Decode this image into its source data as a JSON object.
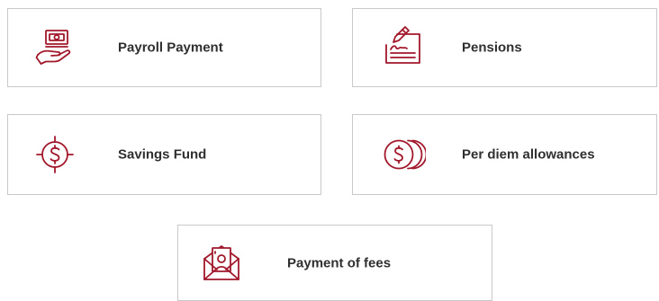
{
  "accent_color": "#a1182b",
  "services": [
    {
      "id": "payroll",
      "label": "Payroll Payment",
      "icon": "cash-hand-icon"
    },
    {
      "id": "pensions",
      "label": "Pensions",
      "icon": "signature-document-icon"
    },
    {
      "id": "savings",
      "label": "Savings Fund",
      "icon": "dollar-target-icon"
    },
    {
      "id": "perdiem",
      "label": "Per diem allowances",
      "icon": "coin-stack-icon"
    },
    {
      "id": "fees",
      "label": "Payment of fees",
      "icon": "money-envelope-icon"
    }
  ]
}
